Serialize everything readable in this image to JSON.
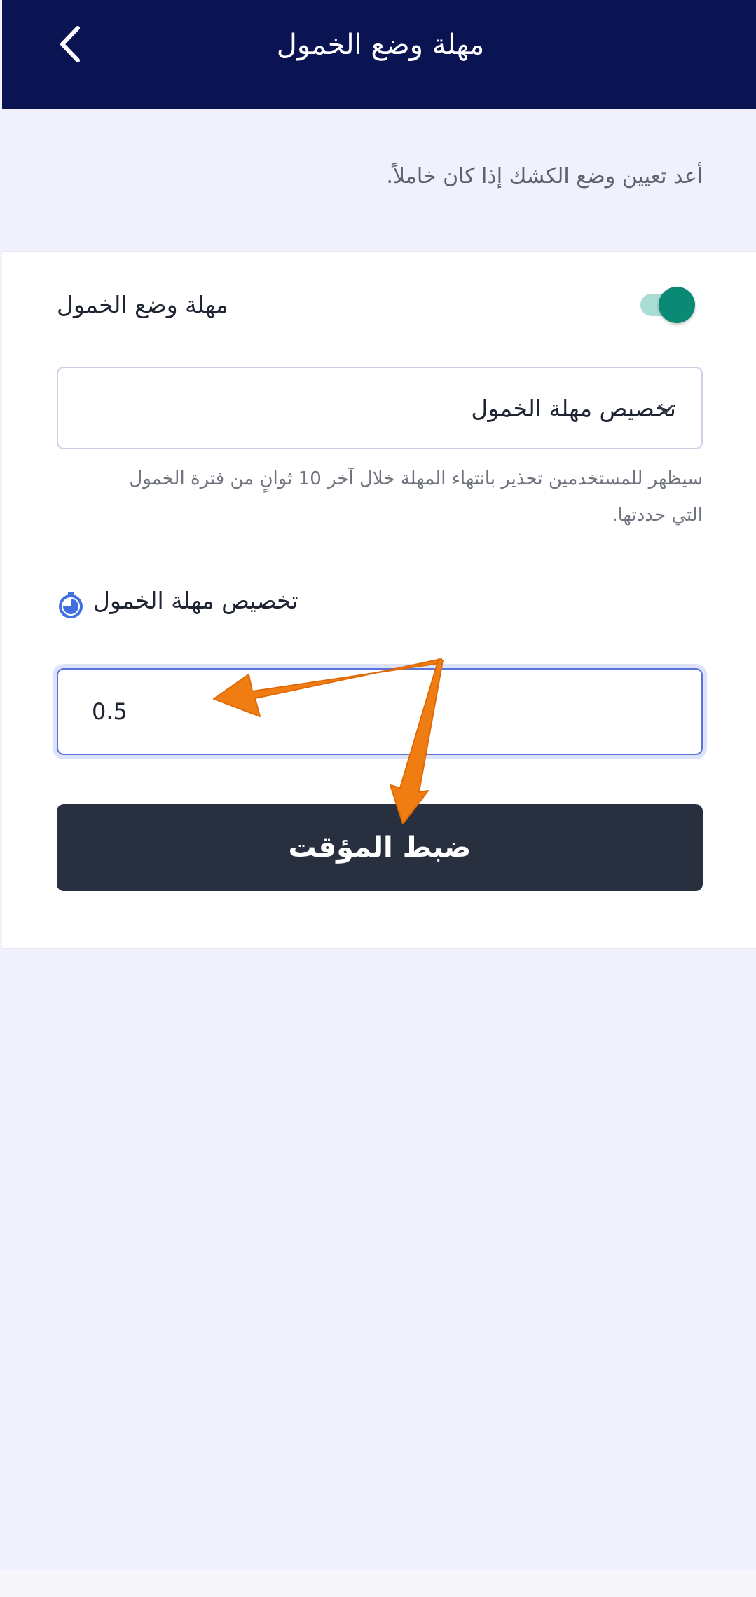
{
  "header": {
    "title": "مهلة وضع الخمول",
    "back_icon": "chevron-left-icon"
  },
  "info": {
    "text": "أعد تعيين وضع الكشك إذا كان خاملاً."
  },
  "idle_timeout": {
    "toggle_label": "مهلة وضع الخمول",
    "toggle_on": true,
    "select_value": "تخصيص مهلة الخمول",
    "help_text": "سيظهر للمستخدمين تحذير بانتهاء المهلة خلال آخر 10 ثوانٍ من فترة الخمول التي حددتها.",
    "custom_label": "تخصيص مهلة الخمول",
    "custom_icon": "timer-icon",
    "input_value": "0.5",
    "button_label": "ضبط المؤقت"
  },
  "colors": {
    "header_bg": "#0b1453",
    "toggle_on": "#0a8a74",
    "button_bg": "#282f3f",
    "focus_border": "#5b73d8",
    "annotation_arrow": "#f07d12"
  }
}
